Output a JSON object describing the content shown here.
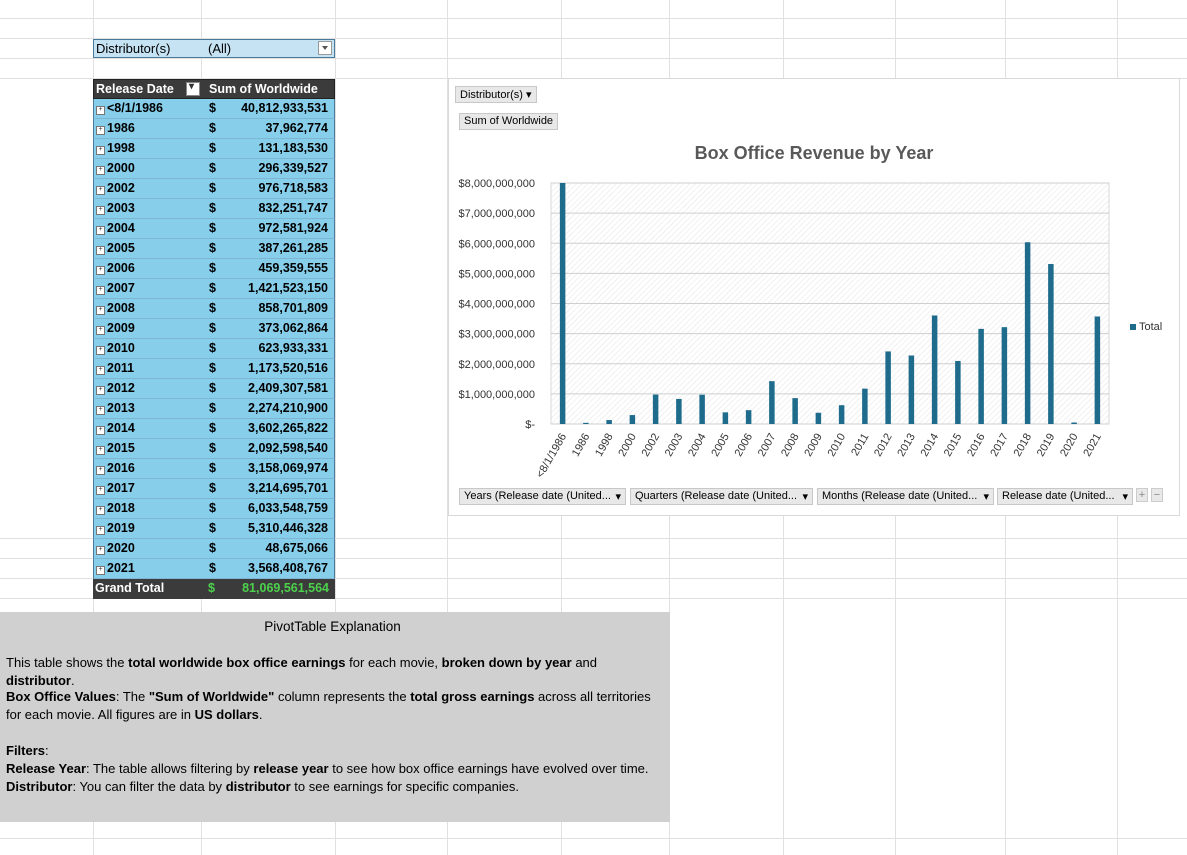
{
  "filter": {
    "label": "Distributor(s)",
    "value": "(All)"
  },
  "pivot": {
    "col1_header": "Release Date",
    "col2_header": "Sum of Worldwide",
    "rows": [
      {
        "label": "<8/1/1986",
        "cur": "$",
        "value": "40,812,933,531"
      },
      {
        "label": "1986",
        "cur": "$",
        "value": "37,962,774"
      },
      {
        "label": "1998",
        "cur": "$",
        "value": "131,183,530"
      },
      {
        "label": "2000",
        "cur": "$",
        "value": "296,339,527"
      },
      {
        "label": "2002",
        "cur": "$",
        "value": "976,718,583"
      },
      {
        "label": "2003",
        "cur": "$",
        "value": "832,251,747"
      },
      {
        "label": "2004",
        "cur": "$",
        "value": "972,581,924"
      },
      {
        "label": "2005",
        "cur": "$",
        "value": "387,261,285"
      },
      {
        "label": "2006",
        "cur": "$",
        "value": "459,359,555"
      },
      {
        "label": "2007",
        "cur": "$",
        "value": "1,421,523,150"
      },
      {
        "label": "2008",
        "cur": "$",
        "value": "858,701,809"
      },
      {
        "label": "2009",
        "cur": "$",
        "value": "373,062,864"
      },
      {
        "label": "2010",
        "cur": "$",
        "value": "623,933,331"
      },
      {
        "label": "2011",
        "cur": "$",
        "value": "1,173,520,516"
      },
      {
        "label": "2012",
        "cur": "$",
        "value": "2,409,307,581"
      },
      {
        "label": "2013",
        "cur": "$",
        "value": "2,274,210,900"
      },
      {
        "label": "2014",
        "cur": "$",
        "value": "3,602,265,822"
      },
      {
        "label": "2015",
        "cur": "$",
        "value": "2,092,598,540"
      },
      {
        "label": "2016",
        "cur": "$",
        "value": "3,158,069,974"
      },
      {
        "label": "2017",
        "cur": "$",
        "value": "3,214,695,701"
      },
      {
        "label": "2018",
        "cur": "$",
        "value": "6,033,548,759"
      },
      {
        "label": "2019",
        "cur": "$",
        "value": "5,310,446,328"
      },
      {
        "label": "2020",
        "cur": "$",
        "value": "48,675,066"
      },
      {
        "label": "2021",
        "cur": "$",
        "value": "3,568,408,767"
      }
    ],
    "total": {
      "label": "Grand Total",
      "cur": "$",
      "value": "81,069,561,564"
    }
  },
  "explanation": {
    "title": "PivotTable Explanation",
    "p1": [
      {
        "t": "This table shows the ",
        "b": false
      },
      {
        "t": "total worldwide box office earnings",
        "b": true
      },
      {
        "t": " for each movie, ",
        "b": false
      },
      {
        "t": "broken down by year",
        "b": true
      },
      {
        "t": " and ",
        "b": false
      },
      {
        "t": "distributor",
        "b": true
      },
      {
        "t": ".",
        "b": false
      }
    ],
    "p2": [
      {
        "t": "Box Office Values",
        "b": true
      },
      {
        "t": ": The ",
        "b": false
      },
      {
        "t": "\"Sum of Worldwide\"",
        "b": true
      },
      {
        "t": " column represents the ",
        "b": false
      },
      {
        "t": "total gross earnings",
        "b": true
      },
      {
        "t": " across all territories for each movie. All figures are in ",
        "b": false
      },
      {
        "t": "US dollars",
        "b": true
      },
      {
        "t": ".",
        "b": false
      }
    ],
    "p3": [
      {
        "t": "Filters",
        "b": true
      },
      {
        "t": ":",
        "b": false
      }
    ],
    "p4": [
      {
        "t": "Release Year",
        "b": true
      },
      {
        "t": ": The table allows filtering by ",
        "b": false
      },
      {
        "t": "release year",
        "b": true
      },
      {
        "t": " to see how box office earnings have evolved over time.",
        "b": false
      }
    ],
    "p5": [
      {
        "t": "Distributor",
        "b": true
      },
      {
        "t": ": You can filter the data by ",
        "b": false
      },
      {
        "t": "distributor",
        "b": true
      },
      {
        "t": " to see earnings for specific companies.",
        "b": false
      }
    ]
  },
  "chart_buttons": {
    "distributor": "Distributor(s)",
    "sum": "Sum of Worldwide",
    "years": "Years (Release date (United...",
    "quarters": "Quarters (Release date (United...",
    "months": "Months (Release date (United...",
    "release": "Release date (United..."
  },
  "chart_data": {
    "type": "bar",
    "title": "Box Office Revenue by Year",
    "categories": [
      "<8/1/1986",
      "1986",
      "1998",
      "2000",
      "2002",
      "2003",
      "2004",
      "2005",
      "2006",
      "2007",
      "2008",
      "2009",
      "2010",
      "2011",
      "2012",
      "2013",
      "2014",
      "2015",
      "2016",
      "2017",
      "2018",
      "2019",
      "2020",
      "2021"
    ],
    "series": [
      {
        "name": "Total",
        "values": [
          40812933531,
          37962774,
          131183530,
          296339527,
          976718583,
          832251747,
          972581924,
          387261285,
          459359555,
          1421523150,
          858701809,
          373062864,
          623933331,
          1173520516,
          2409307581,
          2274210900,
          3602265822,
          2092598540,
          3158069974,
          3214695701,
          6033548759,
          5310446328,
          48675066,
          3568408767
        ]
      }
    ],
    "ylim": [
      0,
      8000000000
    ],
    "yticks": [
      "$-",
      "$1,000,000,000",
      "$2,000,000,000",
      "$3,000,000,000",
      "$4,000,000,000",
      "$5,000,000,000",
      "$6,000,000,000",
      "$7,000,000,000",
      "$8,000,000,000"
    ],
    "legend_position": "right",
    "bar_color": "#1e6b8c",
    "grid": true
  }
}
